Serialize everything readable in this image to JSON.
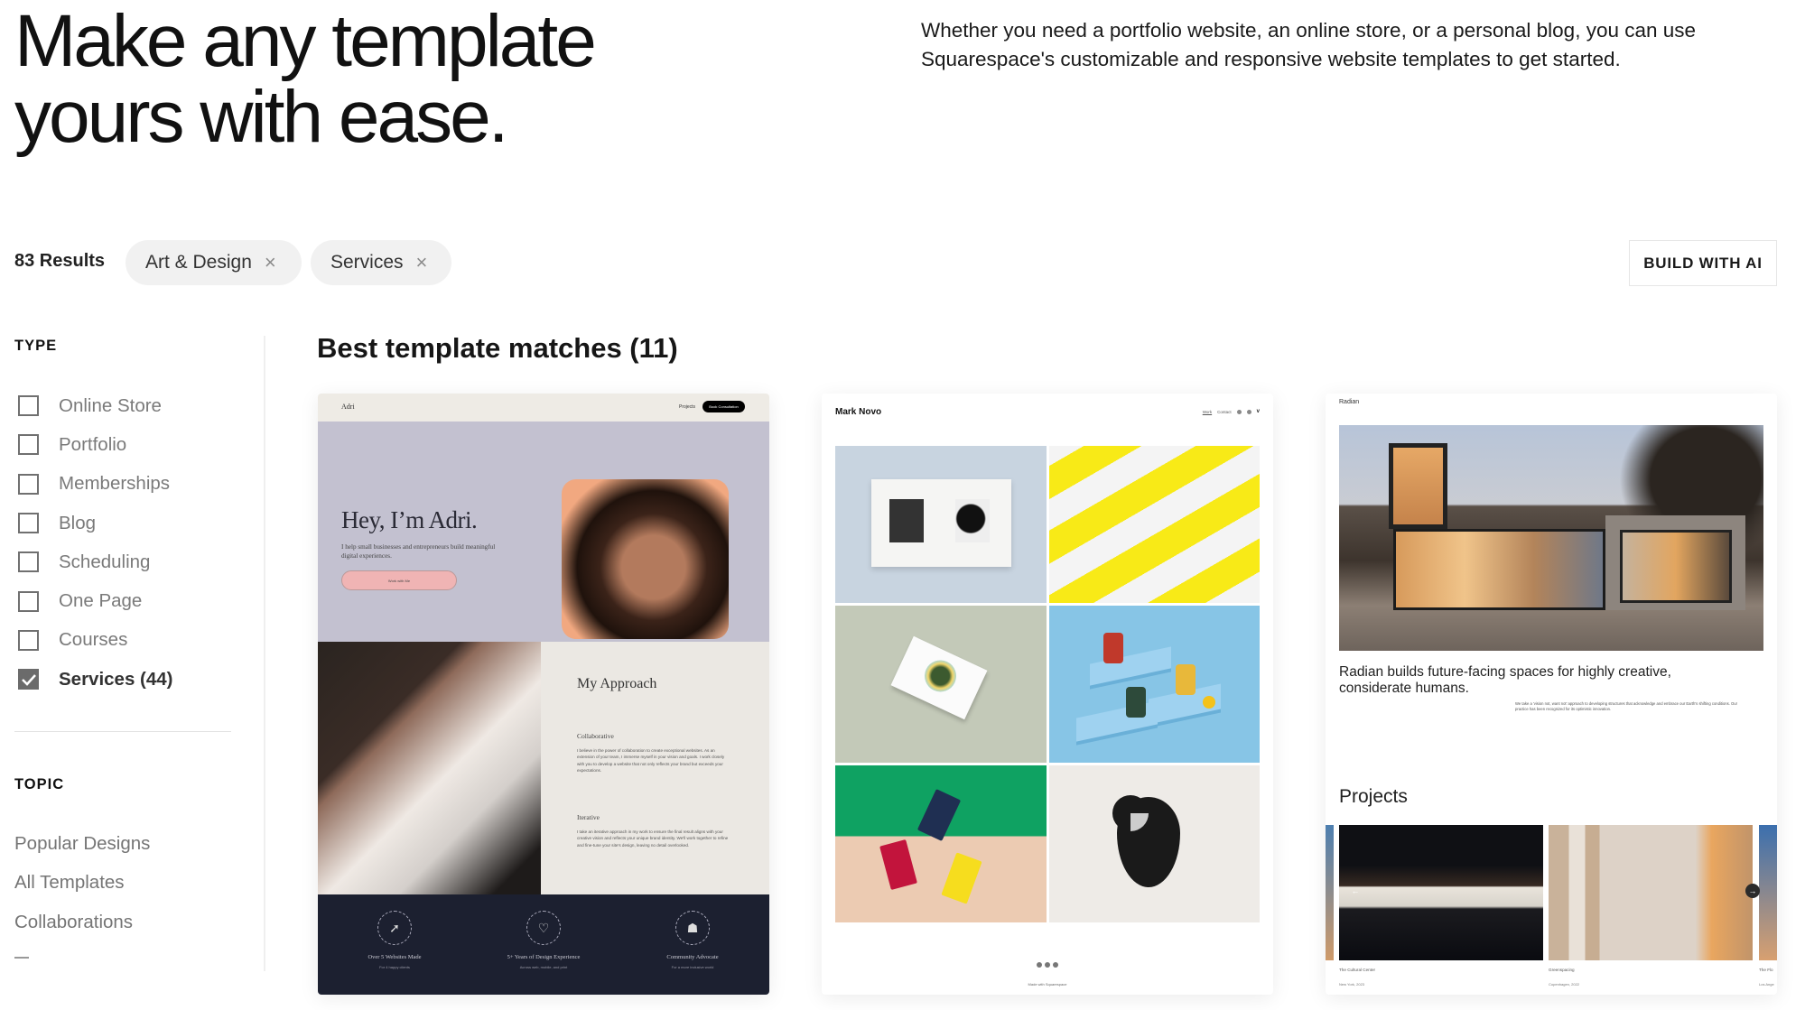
{
  "hero": {
    "title_line1": "Make any template",
    "title_line2": "yours with ease.",
    "description": "Whether you need a portfolio website, an online store, or a personal blog, you can use Squarespace's customizable and responsive website templates to get started."
  },
  "filters": {
    "results_count": "83 Results",
    "active_chips": [
      {
        "label": "Art & Design",
        "remove_icon": "close-icon"
      },
      {
        "label": "Services",
        "remove_icon": "close-icon"
      }
    ],
    "build_with_ai": "BUILD WITH AI"
  },
  "sidebar": {
    "type_heading": "TYPE",
    "type_options": [
      {
        "label": "Online Store",
        "checked": false
      },
      {
        "label": "Portfolio",
        "checked": false
      },
      {
        "label": "Memberships",
        "checked": false
      },
      {
        "label": "Blog",
        "checked": false
      },
      {
        "label": "Scheduling",
        "checked": false
      },
      {
        "label": "One Page",
        "checked": false
      },
      {
        "label": "Courses",
        "checked": false
      },
      {
        "label": "Services (44)",
        "checked": true
      }
    ],
    "topic_heading": "TOPIC",
    "topic_links": [
      "Popular Designs",
      "All Templates",
      "Collaborations"
    ],
    "more_indicator": "—"
  },
  "main": {
    "heading": "Best template matches (11)",
    "templates": [
      {
        "name": "Adri",
        "nav_link": "Projects",
        "nav_cta": "Book Consultation",
        "hero_title": "Hey, I’m Adri.",
        "hero_subtitle": "I help small businesses and entrepreneurs build meaningful digital experiences.",
        "hero_button": "Work with Me",
        "approach_title": "My Approach",
        "approach_items": [
          {
            "title": "Collaborative",
            "text": "I believe in the power of collaboration to create exceptional websites. As an extension of your team, I immerse myself in your vision and goals. I work closely with you to develop a website that not only reflects your brand but exceeds your expectations."
          },
          {
            "title": "Iterative",
            "text": "I take an iterative approach in my work to ensure the final result aligns with your creative vision and reflects your unique brand identity. We'll work together to refine and fine-tune your site's design, leaving no detail overlooked."
          }
        ],
        "stats": [
          {
            "icon": "cursor-icon",
            "title": "Over 5 Websites Made",
            "subtitle": "For 4 happy clients"
          },
          {
            "icon": "heart-icon",
            "title": "5+ Years of Design Experience",
            "subtitle": "Across web, mobile, and print"
          },
          {
            "icon": "community-icon",
            "title": "Community Advocate",
            "subtitle": "For a more inclusive world"
          }
        ]
      },
      {
        "name": "Mark Novo",
        "nav_links": [
          "Work",
          "Contact"
        ],
        "footer_text": "Made with Squarespace"
      },
      {
        "name": "Radian",
        "headline": "Radian builds future-facing spaces for highly creative, considerate humans.",
        "paragraph": "We take a 'vision not, want not' approach to developing structures that acknowledge and embrace our Earth's shifting conditions. Our practice has been recognized for its optimistic innovation.",
        "projects_heading": "Projects",
        "projects": [
          {
            "title": "The Cultural Center",
            "meta": "New York, 2023"
          },
          {
            "title": "Greenspacing",
            "meta": "Copenhagen, 2022"
          },
          {
            "title": "The Flo",
            "meta": "Los Ange"
          }
        ]
      }
    ]
  }
}
